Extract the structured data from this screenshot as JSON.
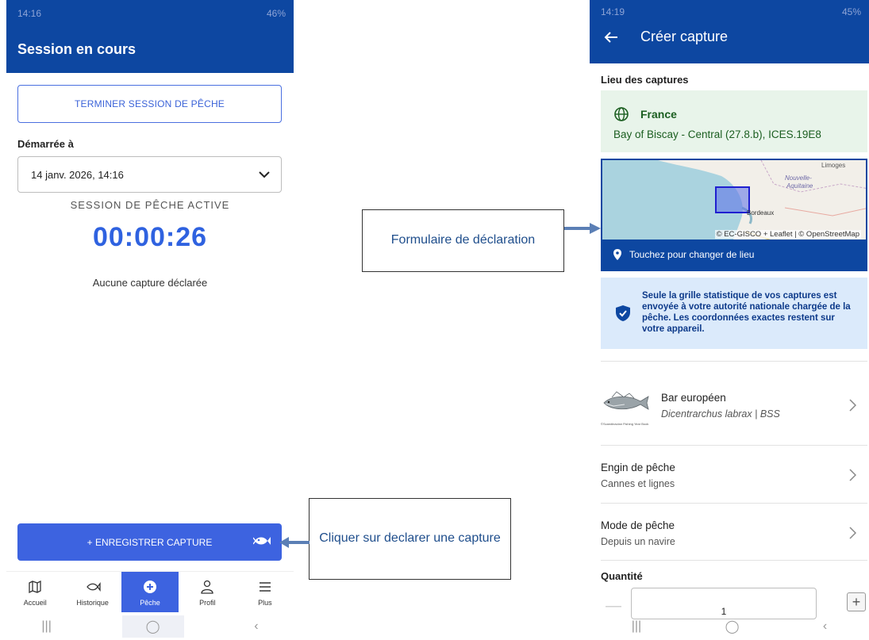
{
  "left_phone": {
    "status": {
      "time": "14:16",
      "battery": "46%"
    },
    "title": "Session en cours",
    "end_button": "TERMINER SESSION DE PÊCHE",
    "started_label": "Démarrée à",
    "started_value": "14 janv. 2026, 14:16",
    "active_label": "SESSION DE PÊCHE ACTIVE",
    "timer": "00:00:26",
    "no_capture": "Aucune capture déclarée",
    "record_button": "+ ENREGISTRER CAPTURE",
    "nav": [
      {
        "label": "Accueil",
        "icon": "map-icon"
      },
      {
        "label": "Historique",
        "icon": "fish-icon"
      },
      {
        "label": "Pêche",
        "icon": "plus-circle-icon",
        "active": true
      },
      {
        "label": "Profil",
        "icon": "person-icon"
      },
      {
        "label": "Plus",
        "icon": "menu-icon"
      }
    ]
  },
  "right_phone": {
    "status": {
      "time": "14:19",
      "battery": "45%"
    },
    "title": "Créer capture",
    "location_section": "Lieu des captures",
    "country": "France",
    "area": "Bay of Biscay - Central (27.8.b), ICES.19E8",
    "map": {
      "labels": {
        "limoges": "Limoges",
        "nouvelle": "Nouvelle-",
        "aquitaine": "Aquitaine",
        "bordeaux": "Bordeaux"
      },
      "attribution": "© EC-GISCO + Leaflet | © OpenStreetMap",
      "change_location": "Touchez pour changer de lieu"
    },
    "privacy_notice": "Seule la grille statistique de vos captures est envoyée à votre autorité nationale chargée de la pêche. Les coordonnées exactes restent sur votre appareil.",
    "species": {
      "name": "Bar européen",
      "latin": "Dicentrarchus labrax",
      "code": "BSS",
      "sub": "Dicentrarchus labrax | BSS",
      "credit": "©Scandinavian Fishing Year Book"
    },
    "gear": {
      "title": "Engin de pêche",
      "value": "Cannes et lignes"
    },
    "mode": {
      "title": "Mode de pêche",
      "value": "Depuis un navire"
    },
    "quantity_label": "Quantité",
    "quantity_value": "1"
  },
  "callouts": {
    "form": "Formulaire de déclaration",
    "declare": "Cliquer sur declarer une capture"
  },
  "colors": {
    "appbar": "#0d47a1",
    "primary": "#3d63e0",
    "success_bg": "#e8f4ea",
    "info_bg": "#dbeafb",
    "callout_text": "#1f4e8c",
    "arrow": "#5b7fb5"
  }
}
